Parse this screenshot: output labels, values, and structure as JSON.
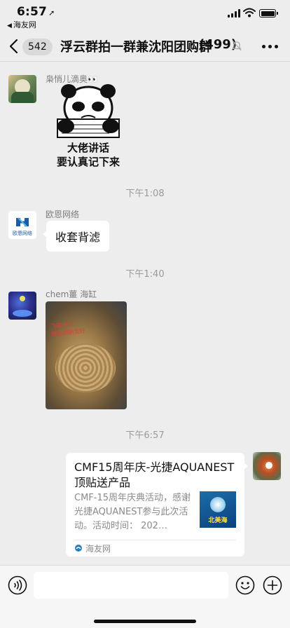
{
  "status_bar": {
    "time": "6:57",
    "back_app": "海友网"
  },
  "nav": {
    "unread_count": "542",
    "title": "浮云群拍一群兼沈阳团购群",
    "member_count": "(499)"
  },
  "messages": [
    {
      "sender": "枭悄儿滴奥👀",
      "sticker_text_line1": "大佬讲话",
      "sticker_text_line2": "要认真记下来"
    },
    {
      "timestamp": "下午1:08",
      "sender": "欧恩网络",
      "avatar_label": "欧恩网络",
      "text": "收套背滤"
    },
    {
      "timestamp": "下午1:40",
      "sender": "chem薑 海缸",
      "photo_overlay_line1": "飞碟珊瑚",
      "photo_overlay_line2": "颜色翻新完好"
    },
    {
      "timestamp": "下午6:57",
      "card_title": "CMF15周年庆-光捷AQUANEST顶贴送产品",
      "card_desc": "CMF-15周年庆典活动，感谢光捷AQUANEST参与此次活动。活动时间： 202…",
      "card_thumb_label": "北美海",
      "card_source": "海友网"
    }
  ],
  "input_bar": {
    "placeholder": ""
  }
}
